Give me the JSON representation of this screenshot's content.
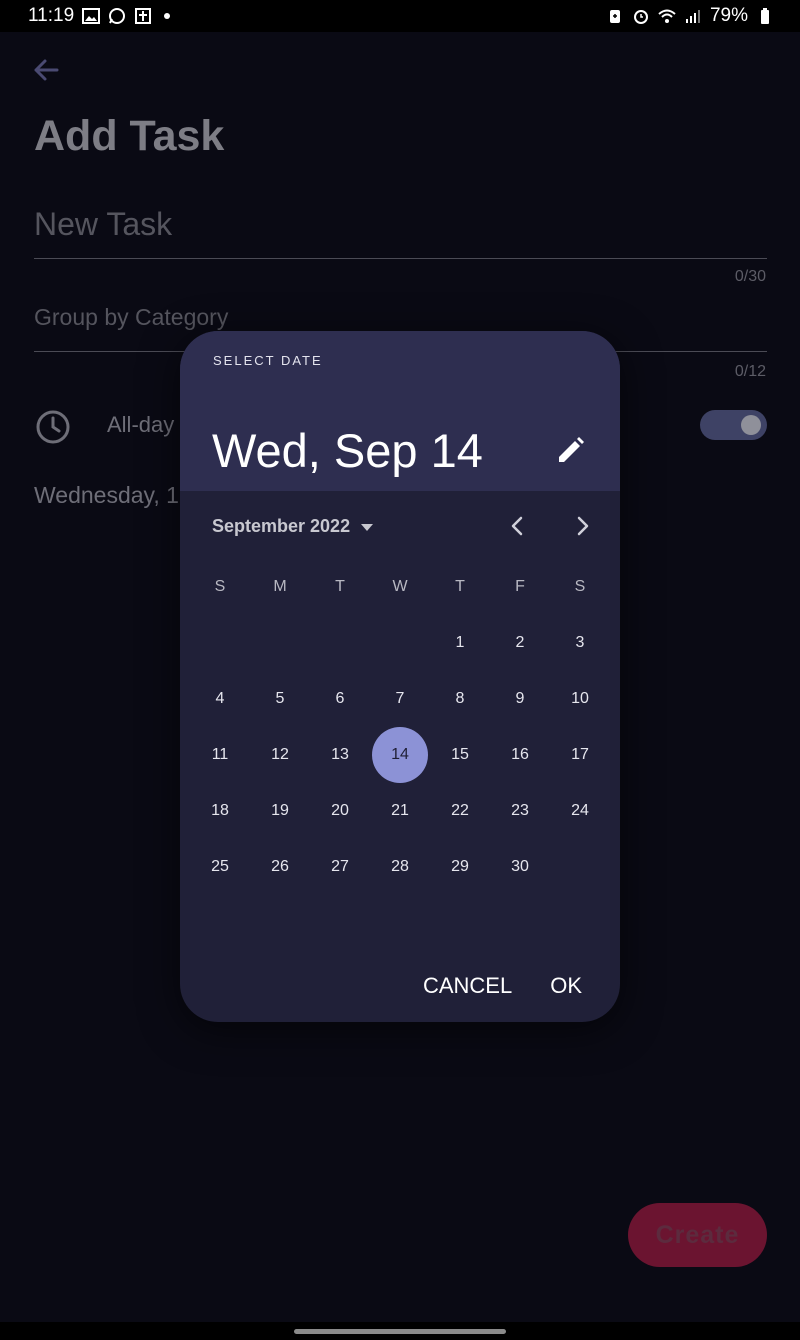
{
  "status_bar": {
    "time": "11:19",
    "battery": "79%"
  },
  "page": {
    "title": "Add Task",
    "task_placeholder": "New Task",
    "task_counter": "0/30",
    "category_placeholder": "Group by Category",
    "category_counter": "0/12",
    "allday_label": "All-day",
    "date_text": "Wednesday, 1",
    "create_label": "Create"
  },
  "dialog": {
    "header_label": "SELECT DATE",
    "selected_date": "Wed, Sep 14",
    "month_label": "September 2022",
    "weekdays": [
      "S",
      "M",
      "T",
      "W",
      "T",
      "F",
      "S"
    ],
    "leading_blanks": 4,
    "days": [
      "1",
      "2",
      "3",
      "4",
      "5",
      "6",
      "7",
      "8",
      "9",
      "10",
      "11",
      "12",
      "13",
      "14",
      "15",
      "16",
      "17",
      "18",
      "19",
      "20",
      "21",
      "22",
      "23",
      "24",
      "25",
      "26",
      "27",
      "28",
      "29",
      "30"
    ],
    "selected_day": "14",
    "cancel_label": "CANCEL",
    "ok_label": "OK"
  },
  "colors": {
    "dialog_bg": "#202038",
    "header_bg": "#2e2e50",
    "selected_day_bg": "#8c92d6",
    "create_button": "#6b1430"
  }
}
